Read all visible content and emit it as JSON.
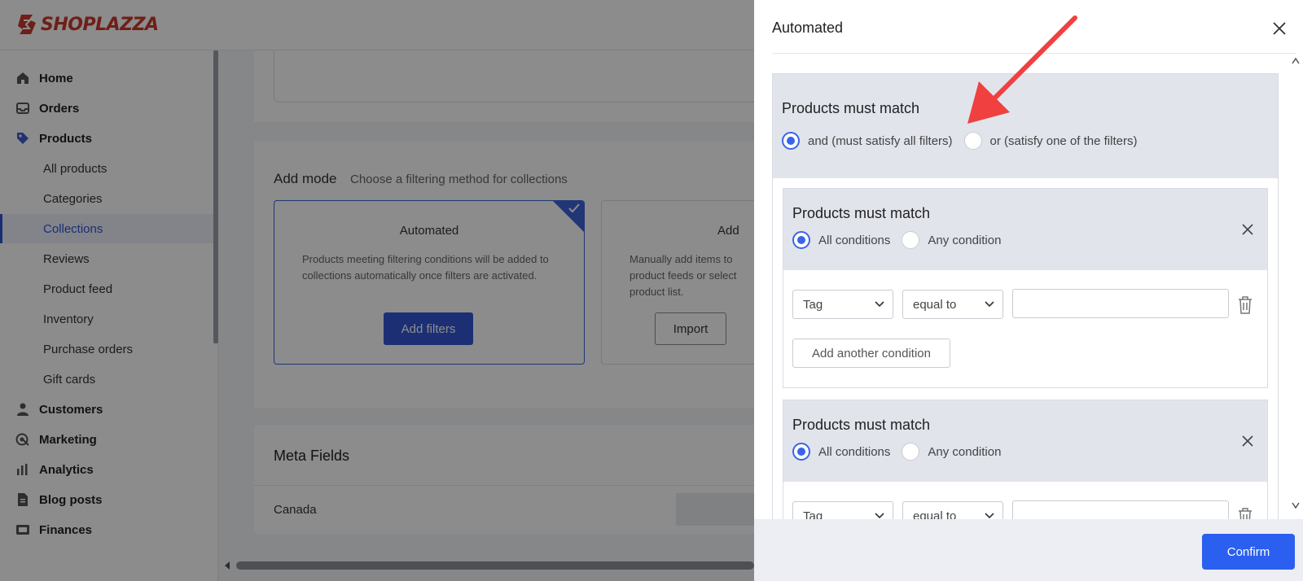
{
  "app": {
    "logo_text": "SHOPLAZZA"
  },
  "sidebar": {
    "items": [
      {
        "label": "Home",
        "icon": "home-icon"
      },
      {
        "label": "Orders",
        "icon": "inbox-icon"
      },
      {
        "label": "Products",
        "icon": "tag-icon"
      },
      {
        "label": "Customers",
        "icon": "user-icon"
      },
      {
        "label": "Marketing",
        "icon": "target-icon"
      },
      {
        "label": "Analytics",
        "icon": "bar-chart-icon"
      },
      {
        "label": "Blog posts",
        "icon": "document-icon"
      },
      {
        "label": "Finances",
        "icon": "wallet-icon"
      }
    ],
    "product_subitems": [
      "All products",
      "Categories",
      "Collections",
      "Reviews",
      "Product feed",
      "Inventory",
      "Purchase orders",
      "Gift cards"
    ],
    "active_subitem": "Collections"
  },
  "main": {
    "add_mode": {
      "title": "Add mode",
      "subtitle": "Choose a filtering method for collections",
      "automated": {
        "title": "Automated",
        "description": "Products meeting filtering conditions will be added to collections automatically once filters are activated.",
        "button": "Add filters"
      },
      "manual": {
        "title": "Add",
        "description_lines": [
          "Manually add items to",
          "product feeds or select",
          "product list."
        ],
        "button": "Import"
      }
    },
    "meta_fields": {
      "title": "Meta Fields",
      "value": "Canada"
    }
  },
  "drawer": {
    "title": "Automated",
    "top_match": {
      "title": "Products must match",
      "options": [
        "and (must satisfy all filters)",
        "or (satisfy one of the filters)"
      ],
      "selected": 0
    },
    "groups": [
      {
        "title": "Products must match",
        "options": [
          "All conditions",
          "Any condition"
        ],
        "selected": 0,
        "condition": {
          "field": "Tag",
          "operator": "equal to",
          "value": ""
        },
        "add_button": "Add another condition"
      },
      {
        "title": "Products must match",
        "options": [
          "All conditions",
          "Any condition"
        ],
        "selected": 0,
        "condition": {
          "field": "Tag",
          "operator": "equal to",
          "value": ""
        }
      }
    ],
    "confirm_button": "Confirm"
  },
  "colors": {
    "brand": "#c83a2c",
    "primary": "#2b5ff0",
    "radio_active": "#3a64e8",
    "annotation_arrow": "#f04040"
  }
}
